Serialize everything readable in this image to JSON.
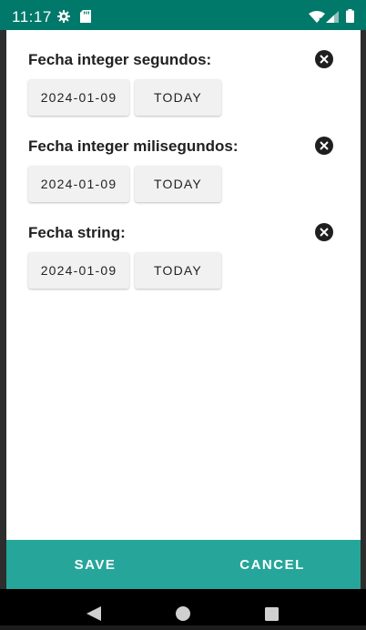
{
  "status_bar": {
    "time": "11:17",
    "icons": [
      "gear-icon",
      "sd-card-icon",
      "wifi-icon",
      "signal-icon",
      "battery-icon"
    ]
  },
  "fields": [
    {
      "label": "Fecha integer segundos:",
      "date_value": "2024-01-09",
      "today_label": "TODAY"
    },
    {
      "label": "Fecha integer milisegundos:",
      "date_value": "2024-01-09",
      "today_label": "TODAY"
    },
    {
      "label": "Fecha string:",
      "date_value": "2024-01-09",
      "today_label": "TODAY"
    }
  ],
  "actions": {
    "save_label": "SAVE",
    "cancel_label": "CANCEL"
  },
  "colors": {
    "status_bar": "#00796b",
    "action_bar": "#26a69a",
    "button_gray": "#f1f1f1"
  },
  "nav_bar": {
    "icons": [
      "back-icon",
      "home-icon",
      "recent-apps-icon"
    ]
  }
}
